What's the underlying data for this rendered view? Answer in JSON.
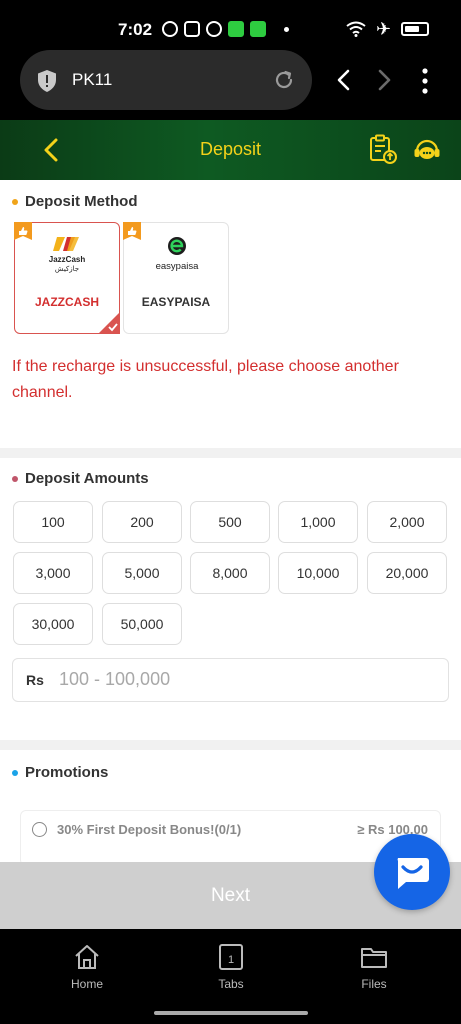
{
  "status_bar": {
    "time": "7:02"
  },
  "browser": {
    "url_text": "PK11"
  },
  "header": {
    "title": "Deposit"
  },
  "deposit_method": {
    "title": "Deposit Method",
    "bullet_color": "#f0a41a",
    "methods": [
      {
        "label": "JAZZCASH",
        "logo_text": "JazzCash",
        "logo_sub": "جازکیش",
        "selected": true
      },
      {
        "label": "EASYPAISA",
        "logo_text": "easypaisa",
        "selected": false
      }
    ],
    "warning": "If the recharge is unsuccessful, please choose another channel."
  },
  "deposit_amounts": {
    "title": "Deposit Amounts",
    "bullet_color": "#c0566a",
    "amounts": [
      "100",
      "200",
      "500",
      "1,000",
      "2,000",
      "3,000",
      "5,000",
      "8,000",
      "10,000",
      "20,000",
      "30,000",
      "50,000"
    ],
    "currency": "Rs",
    "placeholder": "100 - 100,000"
  },
  "promotions": {
    "title": "Promotions",
    "bullet_color": "#1aa3e8",
    "items": [
      {
        "label": "30% First Deposit Bonus!(0/1)",
        "min": "≥ Rs 100.00"
      }
    ]
  },
  "next_button": {
    "label": "Next"
  },
  "bottom_nav": {
    "home": "Home",
    "tabs": "Tabs",
    "tabs_count": "1",
    "files": "Files"
  },
  "colors": {
    "header_text": "#f4d21a",
    "warning": "#d32f2f",
    "selected_border": "#d9534f",
    "chat_fab": "#1565e6"
  }
}
